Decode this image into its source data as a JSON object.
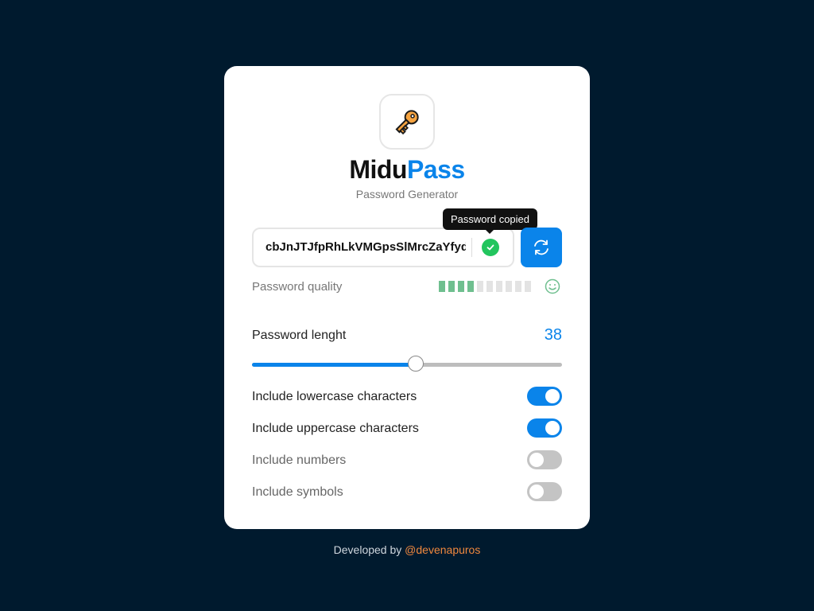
{
  "app": {
    "title_part1": "Midu",
    "title_part2": "Pass",
    "subtitle": "Password Generator",
    "logo_icon": "key-icon"
  },
  "password": {
    "value": "cbJnJTJfpRhLkVMGpsSlMrcZaYfyd",
    "copy_icon": "check-circle-icon",
    "tooltip": "Password copied",
    "refresh_icon": "refresh-icon"
  },
  "quality": {
    "label": "Password quality",
    "segments_total": 10,
    "segments_filled": 4,
    "filled_color": "#6fbf8f",
    "empty_color": "#e3e3e3",
    "icon": "smiley-icon"
  },
  "length": {
    "label": "Password lenght",
    "value": "38",
    "slider_fraction": 0.53
  },
  "options": [
    {
      "label": "Include lowercase characters",
      "checked": true
    },
    {
      "label": "Include uppercase characters",
      "checked": true
    },
    {
      "label": "Include numbers",
      "checked": false
    },
    {
      "label": "Include symbols",
      "checked": false
    }
  ],
  "footer": {
    "prefix": "Developed by",
    "link": "@devenapuros"
  },
  "colors": {
    "background": "#001a2e",
    "accent": "#0a84ea",
    "success": "#22c55e",
    "link": "#f0883e"
  }
}
